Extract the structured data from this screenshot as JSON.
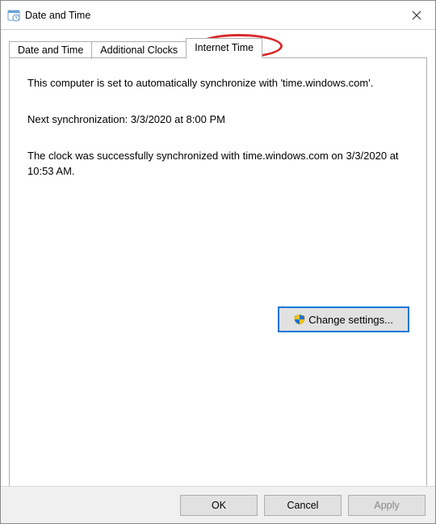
{
  "window": {
    "title": "Date and Time"
  },
  "tabs": [
    {
      "label": "Date and Time"
    },
    {
      "label": "Additional Clocks"
    },
    {
      "label": "Internet Time"
    }
  ],
  "content": {
    "sync_status": "This computer is set to automatically synchronize with 'time.windows.com'.",
    "next_sync": "Next synchronization: 3/3/2020 at 8:00 PM",
    "last_sync": "The clock was successfully synchronized with time.windows.com on 3/3/2020 at 10:53 AM."
  },
  "buttons": {
    "change_settings": "Change settings...",
    "ok": "OK",
    "cancel": "Cancel",
    "apply": "Apply"
  }
}
